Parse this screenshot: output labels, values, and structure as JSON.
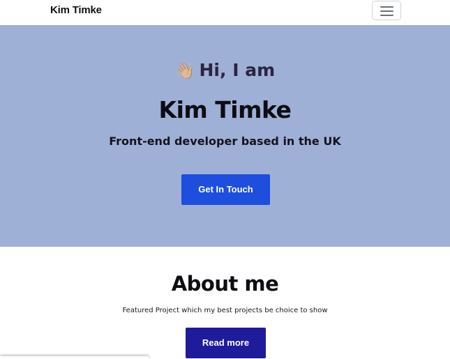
{
  "navbar": {
    "brand": "Kim Timke",
    "toggler_icon": "hamburger-menu-icon"
  },
  "hero": {
    "greeting_emoji": "👋🏼",
    "greeting_text": "Hi, I am",
    "name": "Kim Timke",
    "subtitle": "Front-end developer based in the UK",
    "cta_label": "Get In Touch"
  },
  "about": {
    "title": "About me",
    "text": "Featured Project which my best projects be choice to show",
    "button_label": "Read more"
  },
  "colors": {
    "hero_bg": "#9fb0d7",
    "cta_bg": "#1d4ede",
    "readmore_bg": "#1f1c9c"
  }
}
